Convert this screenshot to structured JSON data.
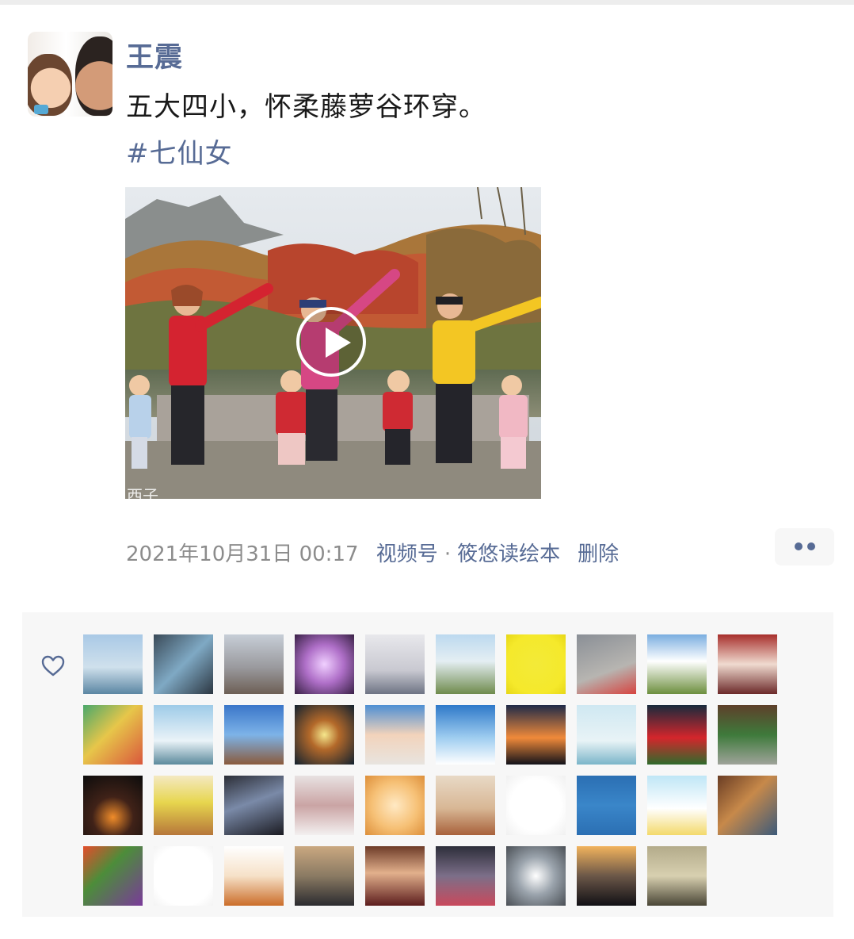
{
  "post": {
    "author": "王震",
    "avatar_icon": "user-avatar",
    "text": "五大四小，怀柔藤萝谷环穿。",
    "hashtag": "#七仙女",
    "video": {
      "play_icon": "play-icon",
      "watermark": "西子"
    },
    "timestamp": "2021年10月31日 00:17",
    "channels_label": "视频号",
    "separator": "·",
    "channel_name": "筱悠读绘本",
    "delete_label": "删除",
    "more_icon": "more-dots-icon"
  },
  "likes": {
    "heart_icon": "heart-icon",
    "colors": {
      "link": "#576b95",
      "meta": "#8c8c8c",
      "panel": "#f7f7f7"
    },
    "avatars": [
      {
        "bg": "linear-gradient(180deg,#a9c9e6 0%,#cfe0ec 55%,#5b86a3 100%)"
      },
      {
        "bg": "linear-gradient(135deg,#3a4a58 0%,#7fa9c4 50%,#2c3742 100%)"
      },
      {
        "bg": "linear-gradient(180deg,#c7ced7 0%,#9a9a9e 55%,#6d5f55 100%)"
      },
      {
        "bg": "radial-gradient(circle,#f0d0ff 0%,#b070c9 45%,#3a2147 100%)"
      },
      {
        "bg": "linear-gradient(180deg,#e8e8ec 0%,#c9c9d1 60%,#6e7484 100%)"
      },
      {
        "bg": "linear-gradient(180deg,#bcd9ef 0%,#e4eef3 45%,#6f8b4d 100%)"
      },
      {
        "bg": "radial-gradient(circle,#f3ea38 0%,#f5e92b 70%,#e7d718 100%)"
      },
      {
        "bg": "linear-gradient(160deg,#8a8f96 0%,#b7b5b1 60%,#d64440 100%)"
      },
      {
        "bg": "linear-gradient(180deg,#7aaee0 0%,#ffffff 45%,#6d8f3f 100%)"
      },
      {
        "bg": "linear-gradient(180deg,#a72f2c 0%,#f0dbd0 50%,#6c2a2a 100%)"
      },
      {
        "bg": "linear-gradient(135deg,#4aa86b 0%,#e7c64a 45%,#d9573c 100%)"
      },
      {
        "bg": "linear-gradient(180deg,#9ecbe8 0%,#eaf3f8 60%,#5c8a9c 100%)"
      },
      {
        "bg": "linear-gradient(180deg,#3a76c9 0%,#7db3e8 50%,#8a5a3c 100%)"
      },
      {
        "bg": "radial-gradient(circle,#f5e78c 0%,#b3692a 35%,#12212f 100%)"
      },
      {
        "bg": "linear-gradient(180deg,#4e8fd3 0%,#f2d3bb 50%,#e8e4df 100%)"
      },
      {
        "bg": "linear-gradient(180deg,#2e79c9 0%,#9fcdf0 55%,#ffffff 100%)"
      },
      {
        "bg": "linear-gradient(180deg,#1e2a48 0%,#f08a3a 55%,#12121a 100%)"
      },
      {
        "bg": "linear-gradient(180deg,#cfe8f2 0%,#e8f3f6 60%,#7bb5c9 100%)"
      },
      {
        "bg": "linear-gradient(180deg,#182a3c 0%,#d4262c 55%,#2f6b2c 100%)"
      },
      {
        "bg": "linear-gradient(180deg,#5e3f2a 0%,#3e7a3b 50%,#9fa39a 100%)"
      },
      {
        "bg": "radial-gradient(circle at 50% 70%,#f08c2a 0%,#402218 40%,#0c0c0c 100%)"
      },
      {
        "bg": "linear-gradient(180deg,#f4e9c2 0%,#e7d64e 45%,#b6763a 100%)"
      },
      {
        "bg": "linear-gradient(160deg,#2c2e37 0%,#7a8aa8 45%,#1b1b22 100%)"
      },
      {
        "bg": "linear-gradient(180deg,#e8e2e2 0%,#caa4a4 50%,#f3f0f0 100%)"
      },
      {
        "bg": "radial-gradient(circle,#ffe9c4 0%,#f6c075 55%,#dd8f3a 100%)"
      },
      {
        "bg": "linear-gradient(180deg,#e8d9c6 0%,#d8b795 55%,#a8613b 100%)"
      },
      {
        "bg": "radial-gradient(circle,#ffffff 0%,#ffffff 60%,#f0f0f0 100%)"
      },
      {
        "bg": "linear-gradient(180deg,#2b6fb3 0%,#3a86c9 50%,#2b6fb3 100%)"
      },
      {
        "bg": "linear-gradient(180deg,#bfe6f6 0%,#ffffff 55%,#f3d96b 100%)"
      },
      {
        "bg": "linear-gradient(135deg,#6a3d24 0%,#c7894a 45%,#3c5a7a 100%)"
      },
      {
        "bg": "linear-gradient(135deg,#e44d2b 0%,#4c8d3a 40%,#7a3a9a 100%)"
      },
      {
        "bg": "radial-gradient(circle,#ffffff 0%,#ffffff 70%,#f3f3f3 100%)"
      },
      {
        "bg": "linear-gradient(180deg,#ffffff 0%,#f6e1c8 50%,#cb6d2a 100%)"
      },
      {
        "bg": "linear-gradient(180deg,#caa880 0%,#8a7a63 50%,#2b2b2f 100%)"
      },
      {
        "bg": "linear-gradient(180deg,#6d3b28 0%,#e2b08c 45%,#5c1d1d 100%)"
      },
      {
        "bg": "linear-gradient(180deg,#2d2e3a 0%,#7c6f89 50%,#c9495c 100%)"
      },
      {
        "bg": "radial-gradient(circle,#ffffff 0%,#9aa3ac 45%,#4a4f55 100%)"
      },
      {
        "bg": "linear-gradient(180deg,#f2b35d 0%,#6b5748 50%,#111015 100%)"
      },
      {
        "bg": "linear-gradient(180deg,#b3ab8a 0%,#d8d0b0 50%,#4a4636 100%)"
      }
    ]
  }
}
